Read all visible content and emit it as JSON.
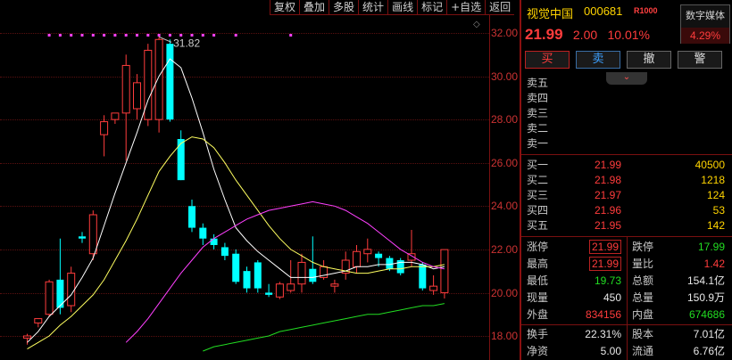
{
  "toolbar": [
    "复权",
    "叠加",
    "多股",
    "统计",
    "画线",
    "标记",
    "+自选",
    "返回"
  ],
  "chart": {
    "y_ticks": [
      "32.00",
      "30.00",
      "28.00",
      "26.00",
      "24.00",
      "22.00",
      "20.00",
      "18.00"
    ],
    "high_label": "31.82",
    "colors": {
      "up": "#ff3c3c",
      "down": "#00ffff",
      "ma5": "#ffffff",
      "ma10": "#ffff60",
      "ma20": "#ff40ff",
      "ma60": "#22dd22",
      "marker": "#ff40ff"
    }
  },
  "chart_data": {
    "type": "candlestick",
    "ylim": [
      17.6,
      32.4
    ],
    "candles": [
      {
        "o": 17.9,
        "h": 18.1,
        "l": 17.6,
        "c": 18.0
      },
      {
        "o": 18.6,
        "h": 18.8,
        "l": 18.4,
        "c": 18.8
      },
      {
        "o": 19.0,
        "h": 20.6,
        "l": 18.9,
        "c": 20.5
      },
      {
        "o": 20.6,
        "h": 22.5,
        "l": 19.0,
        "c": 19.3
      },
      {
        "o": 19.4,
        "h": 21.2,
        "l": 19.1,
        "c": 20.9
      },
      {
        "o": 22.6,
        "h": 22.8,
        "l": 22.3,
        "c": 22.5
      },
      {
        "o": 21.8,
        "h": 23.8,
        "l": 21.5,
        "c": 23.6
      },
      {
        "o": 27.3,
        "h": 28.2,
        "l": 26.3,
        "c": 27.9
      },
      {
        "o": 28.0,
        "h": 28.3,
        "l": 27.8,
        "c": 28.3
      },
      {
        "o": 28.3,
        "h": 31.0,
        "l": 26.1,
        "c": 30.5
      },
      {
        "o": 28.5,
        "h": 30.1,
        "l": 28.0,
        "c": 29.7
      },
      {
        "o": 28.0,
        "h": 31.5,
        "l": 27.7,
        "c": 31.2
      },
      {
        "o": 28.0,
        "h": 31.82,
        "l": 27.4,
        "c": 31.7
      },
      {
        "o": 31.5,
        "h": 31.7,
        "l": 27.9,
        "c": 28.0
      },
      {
        "o": 27.1,
        "h": 27.5,
        "l": 25.2,
        "c": 25.2
      },
      {
        "o": 24.0,
        "h": 24.3,
        "l": 22.8,
        "c": 23.0
      },
      {
        "o": 23.0,
        "h": 23.2,
        "l": 22.2,
        "c": 22.5
      },
      {
        "o": 22.5,
        "h": 22.7,
        "l": 22.0,
        "c": 22.2
      },
      {
        "o": 22.1,
        "h": 22.3,
        "l": 21.5,
        "c": 21.7
      },
      {
        "o": 21.8,
        "h": 22.0,
        "l": 20.4,
        "c": 20.5
      },
      {
        "o": 21.0,
        "h": 21.2,
        "l": 20.0,
        "c": 20.2
      },
      {
        "o": 21.4,
        "h": 21.5,
        "l": 20.0,
        "c": 20.2
      },
      {
        "o": 20.0,
        "h": 20.4,
        "l": 19.8,
        "c": 19.9
      },
      {
        "o": 19.8,
        "h": 20.5,
        "l": 19.7,
        "c": 20.4
      },
      {
        "o": 20.1,
        "h": 21.5,
        "l": 20.0,
        "c": 20.4
      },
      {
        "o": 20.4,
        "h": 21.8,
        "l": 20.0,
        "c": 21.4
      },
      {
        "o": 21.1,
        "h": 22.6,
        "l": 20.4,
        "c": 20.5
      },
      {
        "o": 20.7,
        "h": 21.5,
        "l": 20.6,
        "c": 21.2
      },
      {
        "o": 20.3,
        "h": 20.6,
        "l": 20.0,
        "c": 20.4
      },
      {
        "o": 20.9,
        "h": 21.9,
        "l": 20.6,
        "c": 21.5
      },
      {
        "o": 21.2,
        "h": 22.2,
        "l": 20.9,
        "c": 21.9
      },
      {
        "o": 21.8,
        "h": 22.5,
        "l": 21.4,
        "c": 22.0
      },
      {
        "o": 21.8,
        "h": 21.9,
        "l": 21.2,
        "c": 21.6
      },
      {
        "o": 21.6,
        "h": 21.7,
        "l": 21.0,
        "c": 21.1
      },
      {
        "o": 21.5,
        "h": 21.6,
        "l": 20.8,
        "c": 20.9
      },
      {
        "o": 21.5,
        "h": 22.9,
        "l": 21.2,
        "c": 21.8
      },
      {
        "o": 21.3,
        "h": 21.4,
        "l": 20.1,
        "c": 20.2
      },
      {
        "o": 20.1,
        "h": 20.8,
        "l": 19.9,
        "c": 20.3
      },
      {
        "o": 20.0,
        "h": 21.99,
        "l": 19.73,
        "c": 21.99
      }
    ],
    "ma5": [
      17.7,
      18.2,
      18.9,
      19.4,
      19.9,
      20.7,
      21.6,
      23.1,
      24.6,
      26.0,
      27.4,
      28.9,
      30.0,
      30.8,
      30.4,
      29.0,
      27.4,
      25.7,
      24.3,
      23.0,
      22.4,
      21.9,
      21.5,
      21.1,
      20.7,
      20.7,
      20.7,
      20.8,
      20.9,
      21.0,
      21.2,
      21.2,
      21.3,
      21.3,
      21.4,
      21.4,
      21.3,
      21.1,
      21.2
    ],
    "ma10": [
      17.4,
      17.7,
      18.0,
      18.5,
      18.9,
      19.4,
      19.9,
      20.6,
      21.5,
      22.4,
      23.4,
      24.5,
      25.6,
      26.3,
      26.9,
      27.2,
      27.1,
      26.7,
      26.0,
      25.2,
      24.5,
      23.8,
      23.1,
      22.5,
      22.0,
      21.7,
      21.4,
      21.2,
      21.1,
      21.0,
      20.9,
      20.9,
      21.0,
      21.1,
      21.1,
      21.2,
      21.2,
      21.2,
      21.3
    ],
    "ma20": [
      null,
      null,
      null,
      null,
      null,
      null,
      null,
      null,
      null,
      17.7,
      18.2,
      18.8,
      19.5,
      20.2,
      20.9,
      21.5,
      22.1,
      22.5,
      22.8,
      23.1,
      23.4,
      23.6,
      23.8,
      23.9,
      24.0,
      24.1,
      24.2,
      24.1,
      24.0,
      23.8,
      23.5,
      23.2,
      22.8,
      22.4,
      22.0,
      21.7,
      21.4,
      21.2,
      21.1
    ],
    "ma60": [
      null,
      null,
      null,
      null,
      null,
      null,
      null,
      null,
      null,
      null,
      null,
      null,
      null,
      null,
      null,
      null,
      17.3,
      17.5,
      17.6,
      17.7,
      17.8,
      17.9,
      18.0,
      18.2,
      18.3,
      18.4,
      18.5,
      18.6,
      18.7,
      18.8,
      18.9,
      19.0,
      19.0,
      19.1,
      19.2,
      19.3,
      19.4,
      19.4,
      19.5
    ]
  },
  "quote": {
    "name": "视觉中国",
    "code": "000681",
    "index_tag": "R1000",
    "sector_name": "数字媒体",
    "sector_pct": "4.29%",
    "price": "21.99",
    "change": "2.00",
    "change_pct": "10.01%",
    "buttons": {
      "buy": "买",
      "sell": "卖",
      "cancel": "撤",
      "alert": "警"
    },
    "collapse_icon": "⌄",
    "asks": [
      {
        "label": "卖五",
        "price": "",
        "vol": ""
      },
      {
        "label": "卖四",
        "price": "",
        "vol": ""
      },
      {
        "label": "卖三",
        "price": "",
        "vol": ""
      },
      {
        "label": "卖二",
        "price": "",
        "vol": ""
      },
      {
        "label": "卖一",
        "price": "",
        "vol": ""
      }
    ],
    "bids": [
      {
        "label": "买一",
        "price": "21.99",
        "vol": "40500"
      },
      {
        "label": "买二",
        "price": "21.98",
        "vol": "1218"
      },
      {
        "label": "买三",
        "price": "21.97",
        "vol": "124"
      },
      {
        "label": "买四",
        "price": "21.96",
        "vol": "53"
      },
      {
        "label": "买五",
        "price": "21.95",
        "vol": "142"
      }
    ],
    "stats": [
      {
        "l1": "涨停",
        "v1": "21.99",
        "l2": "跌停",
        "v2": "17.99"
      },
      {
        "l1": "最高",
        "v1": "21.99",
        "l2": "量比",
        "v2": "1.42"
      },
      {
        "l1": "最低",
        "v1": "19.73",
        "l2": "总额",
        "v2": "154.1亿"
      },
      {
        "l1": "现量",
        "v1": "450",
        "l2": "总量",
        "v2": "150.9万"
      },
      {
        "l1": "外盘",
        "v1": "834156",
        "l2": "内盘",
        "v2": "674686"
      }
    ],
    "stats2": [
      {
        "l1": "换手",
        "v1": "22.31%",
        "l2": "股本",
        "v2": "7.01亿"
      },
      {
        "l1": "净资",
        "v1": "5.00",
        "l2": "流通",
        "v2": "6.76亿"
      }
    ]
  }
}
